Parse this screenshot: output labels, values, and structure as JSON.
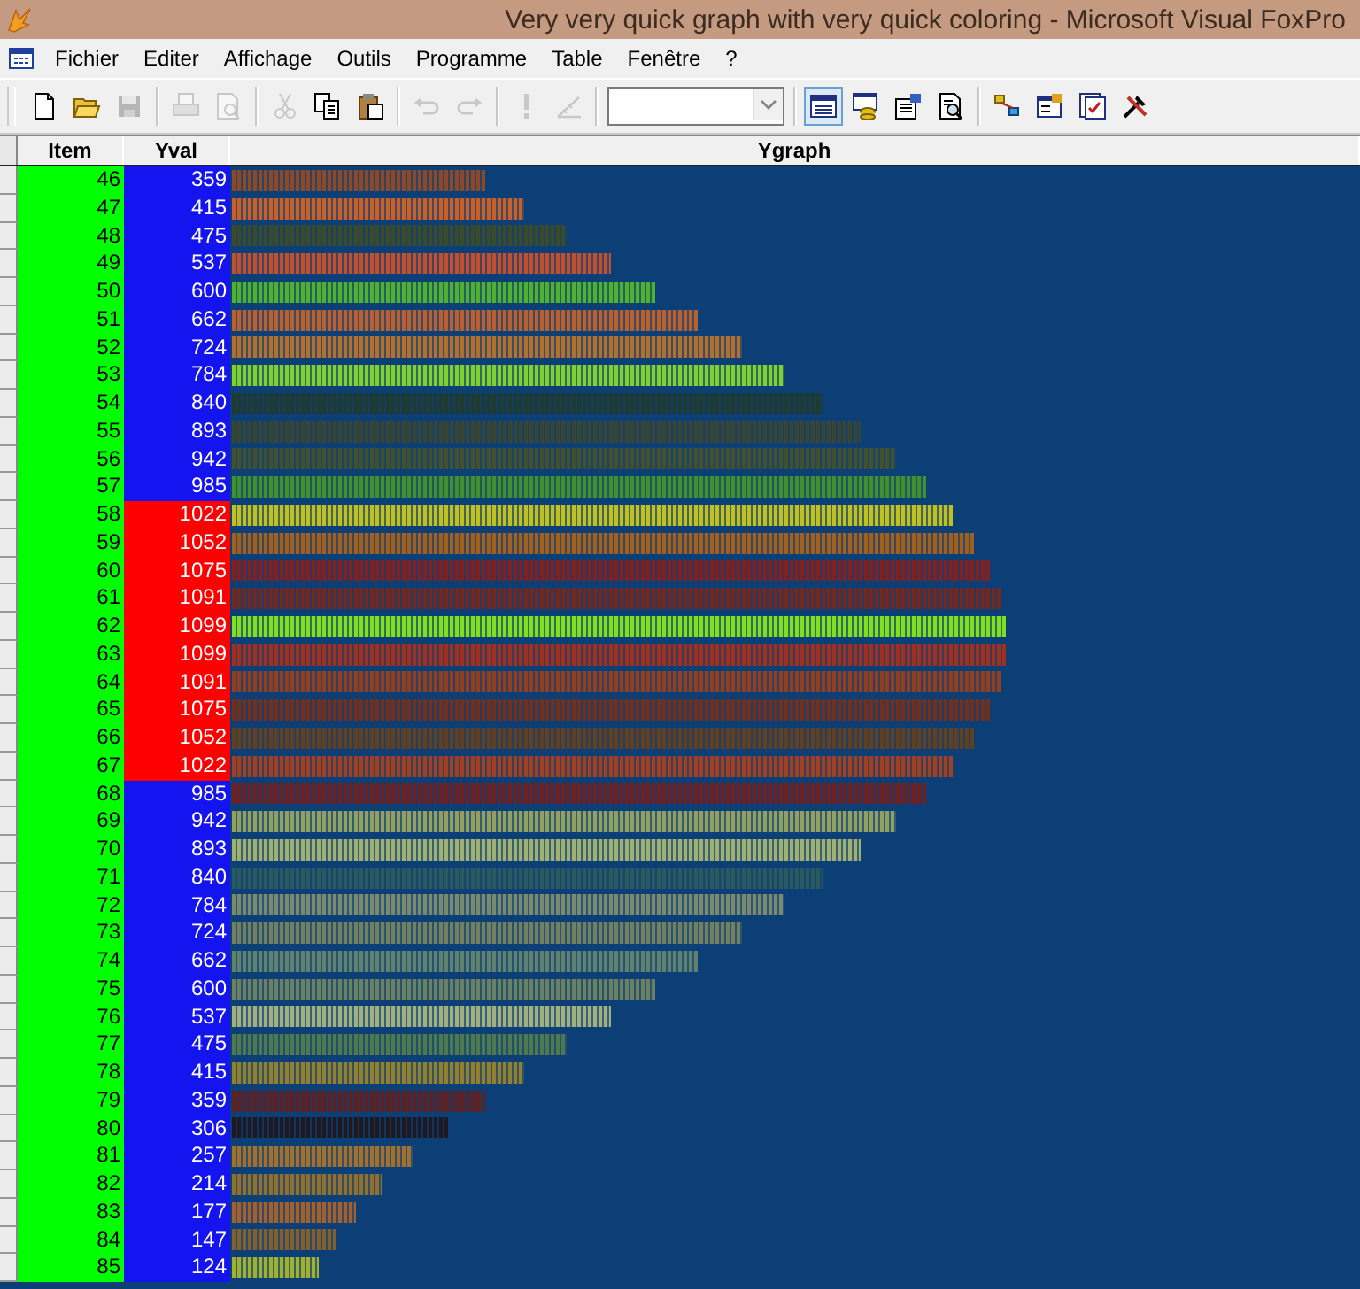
{
  "window": {
    "title": "Very very quick graph with very quick coloring  - Microsoft Visual FoxPro"
  },
  "menu": [
    "Fichier",
    "Editer",
    "Affichage",
    "Outils",
    "Programme",
    "Table",
    "Fenêtre",
    "?"
  ],
  "toolbar": [
    {
      "kind": "new",
      "disabled": false
    },
    {
      "kind": "open",
      "disabled": false
    },
    {
      "kind": "save",
      "disabled": true
    },
    {
      "kind": "sep"
    },
    {
      "kind": "print",
      "disabled": true
    },
    {
      "kind": "preview",
      "disabled": true
    },
    {
      "kind": "sep"
    },
    {
      "kind": "cut",
      "disabled": true
    },
    {
      "kind": "copy",
      "disabled": false
    },
    {
      "kind": "paste",
      "disabled": false
    },
    {
      "kind": "sep"
    },
    {
      "kind": "undo",
      "disabled": true
    },
    {
      "kind": "redo",
      "disabled": true
    },
    {
      "kind": "sep"
    },
    {
      "kind": "run",
      "disabled": true
    },
    {
      "kind": "wizard",
      "disabled": true
    },
    {
      "kind": "sep"
    },
    {
      "kind": "combo"
    },
    {
      "kind": "sep"
    },
    {
      "kind": "window",
      "disabled": false,
      "selected": true
    },
    {
      "kind": "data",
      "disabled": false
    },
    {
      "kind": "props",
      "disabled": false
    },
    {
      "kind": "find",
      "disabled": false
    },
    {
      "kind": "sep"
    },
    {
      "kind": "class",
      "disabled": false
    },
    {
      "kind": "form",
      "disabled": false
    },
    {
      "kind": "report",
      "disabled": false
    },
    {
      "kind": "tools",
      "disabled": false
    }
  ],
  "table": {
    "columns": [
      "Item",
      "Yval",
      "Ygraph"
    ],
    "rows": [
      {
        "item": "46",
        "yval": "359",
        "alert": false,
        "color": "#8a4a2a"
      },
      {
        "item": "47",
        "yval": "415",
        "alert": false,
        "color": "#c8602a"
      },
      {
        "item": "48",
        "yval": "475",
        "alert": false,
        "color": "#3a4a2a"
      },
      {
        "item": "49",
        "yval": "537",
        "alert": false,
        "color": "#c05030"
      },
      {
        "item": "50",
        "yval": "600",
        "alert": false,
        "color": "#50b030"
      },
      {
        "item": "51",
        "yval": "662",
        "alert": false,
        "color": "#b86030"
      },
      {
        "item": "52",
        "yval": "724",
        "alert": false,
        "color": "#b07030"
      },
      {
        "item": "53",
        "yval": "784",
        "alert": false,
        "color": "#80d030"
      },
      {
        "item": "54",
        "yval": "840",
        "alert": false,
        "color": "#203a30"
      },
      {
        "item": "55",
        "yval": "893",
        "alert": false,
        "color": "#384530"
      },
      {
        "item": "56",
        "yval": "942",
        "alert": false,
        "color": "#405030"
      },
      {
        "item": "57",
        "yval": "985",
        "alert": false,
        "color": "#409030"
      },
      {
        "item": "58",
        "yval": "1022",
        "alert": true,
        "color": "#c0c020"
      },
      {
        "item": "59",
        "yval": "1052",
        "alert": true,
        "color": "#a06020"
      },
      {
        "item": "60",
        "yval": "1075",
        "alert": true,
        "color": "#802020"
      },
      {
        "item": "61",
        "yval": "1091",
        "alert": true,
        "color": "#702820"
      },
      {
        "item": "62",
        "yval": "1099",
        "alert": true,
        "color": "#80e020"
      },
      {
        "item": "63",
        "yval": "1099",
        "alert": true,
        "color": "#a03020"
      },
      {
        "item": "64",
        "yval": "1091",
        "alert": true,
        "color": "#904020"
      },
      {
        "item": "65",
        "yval": "1075",
        "alert": true,
        "color": "#703020"
      },
      {
        "item": "66",
        "yval": "1052",
        "alert": true,
        "color": "#604020"
      },
      {
        "item": "67",
        "yval": "1022",
        "alert": true,
        "color": "#a04020"
      },
      {
        "item": "68",
        "yval": "985",
        "alert": false,
        "color": "#702020"
      },
      {
        "item": "69",
        "yval": "942",
        "alert": false,
        "color": "#90a060"
      },
      {
        "item": "70",
        "yval": "893",
        "alert": false,
        "color": "#a0b070"
      },
      {
        "item": "71",
        "yval": "840",
        "alert": false,
        "color": "#2a5a60"
      },
      {
        "item": "72",
        "yval": "784",
        "alert": false,
        "color": "#7a8a70"
      },
      {
        "item": "73",
        "yval": "724",
        "alert": false,
        "color": "#708060"
      },
      {
        "item": "74",
        "yval": "662",
        "alert": false,
        "color": "#608070"
      },
      {
        "item": "75",
        "yval": "600",
        "alert": false,
        "color": "#6a8060"
      },
      {
        "item": "76",
        "yval": "537",
        "alert": false,
        "color": "#a0b080"
      },
      {
        "item": "77",
        "yval": "475",
        "alert": false,
        "color": "#507850"
      },
      {
        "item": "78",
        "yval": "415",
        "alert": false,
        "color": "#908030"
      },
      {
        "item": "79",
        "yval": "359",
        "alert": false,
        "color": "#602020"
      },
      {
        "item": "80",
        "yval": "306",
        "alert": false,
        "color": "#201820"
      },
      {
        "item": "81",
        "yval": "257",
        "alert": false,
        "color": "#a07030"
      },
      {
        "item": "82",
        "yval": "214",
        "alert": false,
        "color": "#907030"
      },
      {
        "item": "83",
        "yval": "177",
        "alert": false,
        "color": "#a06030"
      },
      {
        "item": "84",
        "yval": "147",
        "alert": false,
        "color": "#806030"
      },
      {
        "item": "85",
        "yval": "124",
        "alert": false,
        "color": "#a0b030"
      }
    ]
  }
}
